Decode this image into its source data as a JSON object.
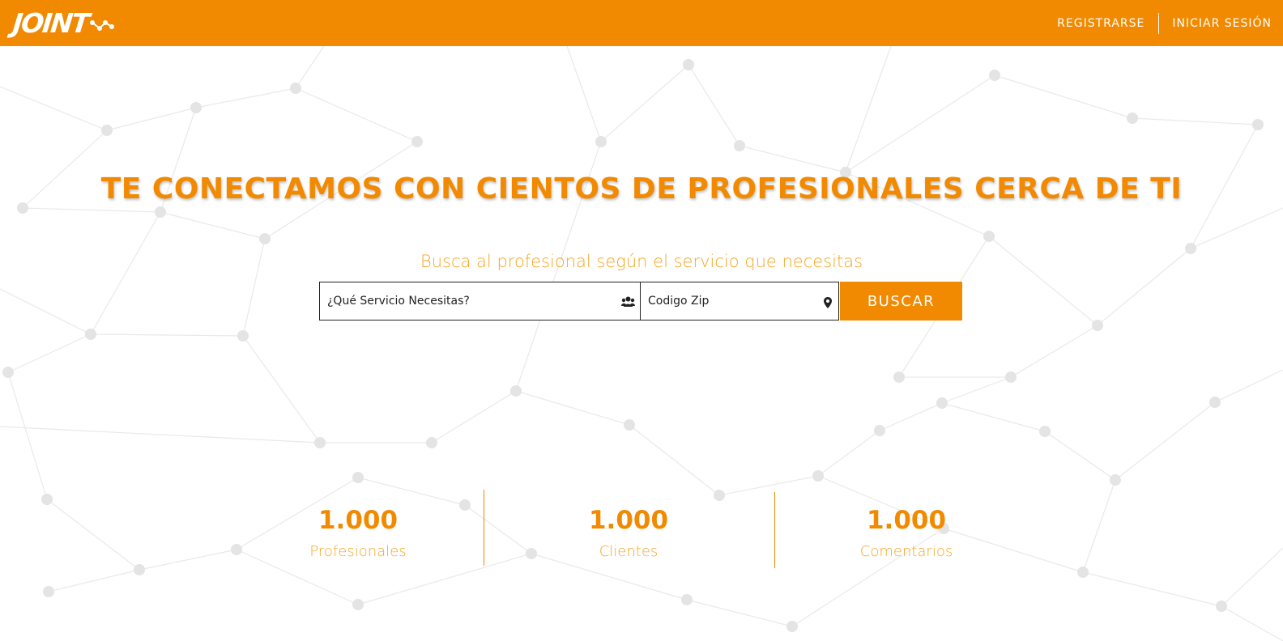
{
  "header": {
    "logo_text": "JOINT",
    "nav": {
      "register_label": "REGISTRARSE",
      "login_label": "INICIAR SESIÓN"
    }
  },
  "hero": {
    "title": "TE CONECTAMOS CON CIENTOS DE PROFESIONALES CERCA DE TI",
    "subtitle": "Busca al profesional según el servicio que necesitas"
  },
  "search": {
    "service_placeholder": "¿Qué Servicio Necesitas?",
    "service_icon": "users-icon",
    "zip_placeholder": "Codigo Zip",
    "zip_icon": "map-pin-icon",
    "button_label": "BUSCAR"
  },
  "stats": [
    {
      "value": "1.000",
      "label": "Profesionales"
    },
    {
      "value": "1.000",
      "label": "Clientes"
    },
    {
      "value": "1.000",
      "label": "Comentarios"
    }
  ],
  "colors": {
    "brand": "#f18a00",
    "accent_light": "#f5a623",
    "background": "#ffffff"
  }
}
